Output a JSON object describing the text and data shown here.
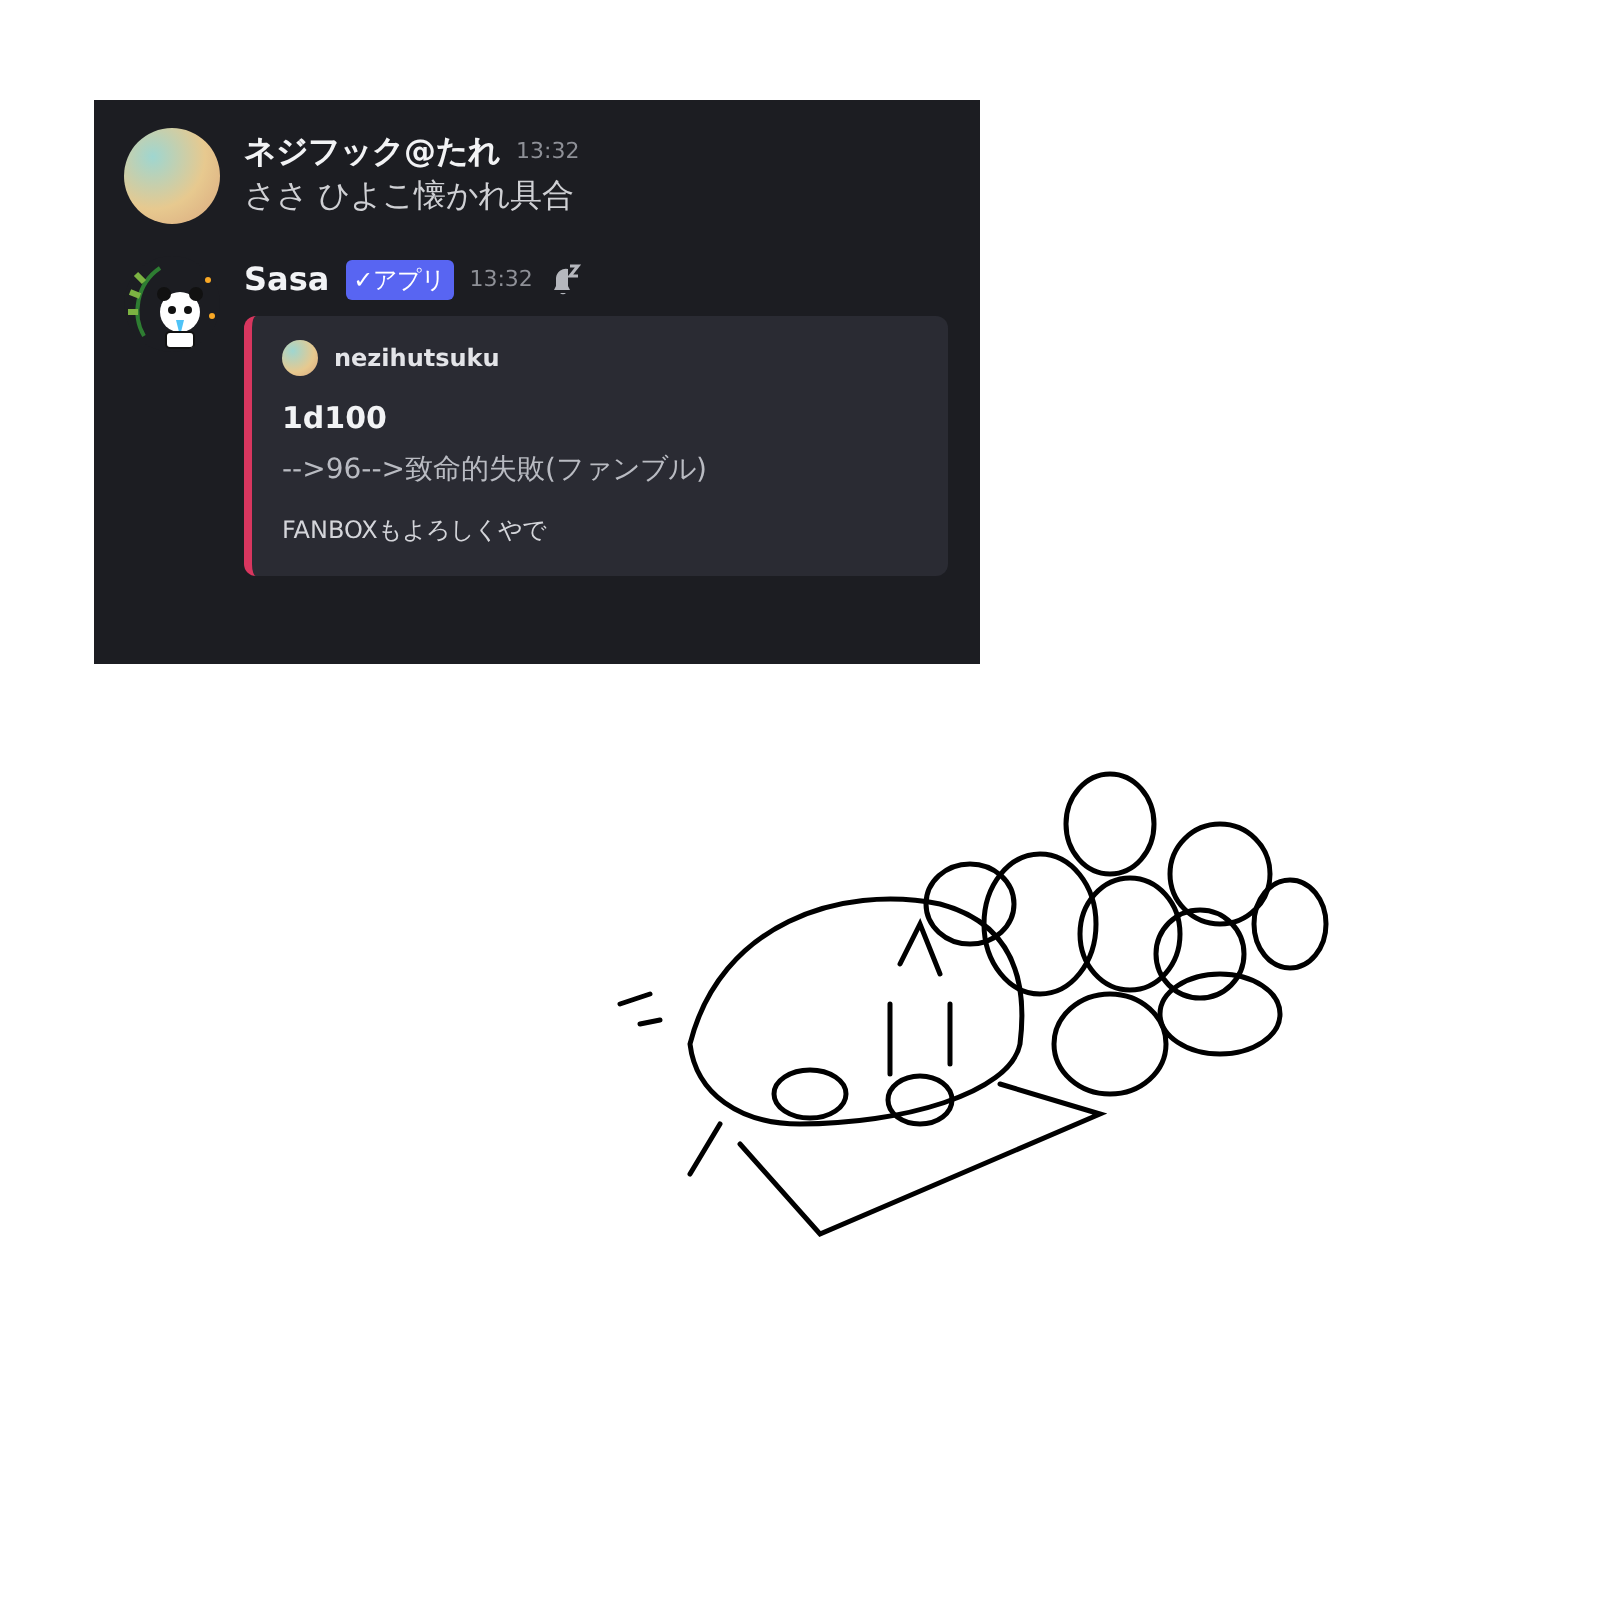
{
  "messages": [
    {
      "author": "ネジフック@たれ",
      "time": "13:32",
      "text": "ささ ひよこ懐かれ具合"
    },
    {
      "author": "Sasa",
      "badge": "✓アプリ",
      "time": "13:32",
      "embed": {
        "author": "nezihutsuku",
        "title": "1d100",
        "description": "-->96-->致命的失敗(ファンブル)",
        "footer": "FANBOXもよろしくやで"
      }
    }
  ]
}
